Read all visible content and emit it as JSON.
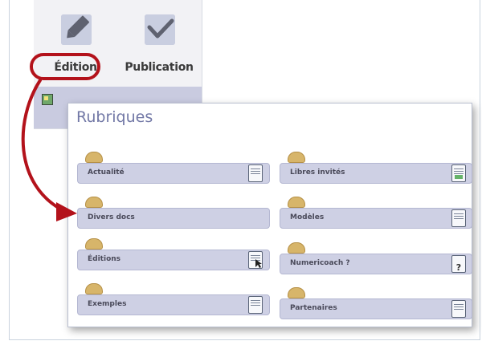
{
  "toolbar": {
    "edition_label": "Édition",
    "publication_label": "Publication"
  },
  "panel": {
    "title": "Rubriques",
    "items": [
      {
        "label": "Actualité",
        "doc_icon": "document-icon"
      },
      {
        "label": "Libres invités",
        "doc_icon": "document-green-icon"
      },
      {
        "label": "Divers docs",
        "doc_icon": ""
      },
      {
        "label": "Modèles",
        "doc_icon": "document-icon"
      },
      {
        "label": "Éditions",
        "doc_icon": "document-cursor-icon"
      },
      {
        "label": "Numericoach ?",
        "doc_icon": "document-question-icon"
      },
      {
        "label": "Exemples",
        "doc_icon": "document-icon"
      },
      {
        "label": "Partenaires",
        "doc_icon": "document-icon"
      }
    ]
  },
  "highlight": {
    "color": "#b3121b",
    "target": "Édition"
  },
  "colors": {
    "accent": "#7278a6",
    "folder_tab": "#d7b56a",
    "item_bg": "#ced0e4"
  }
}
